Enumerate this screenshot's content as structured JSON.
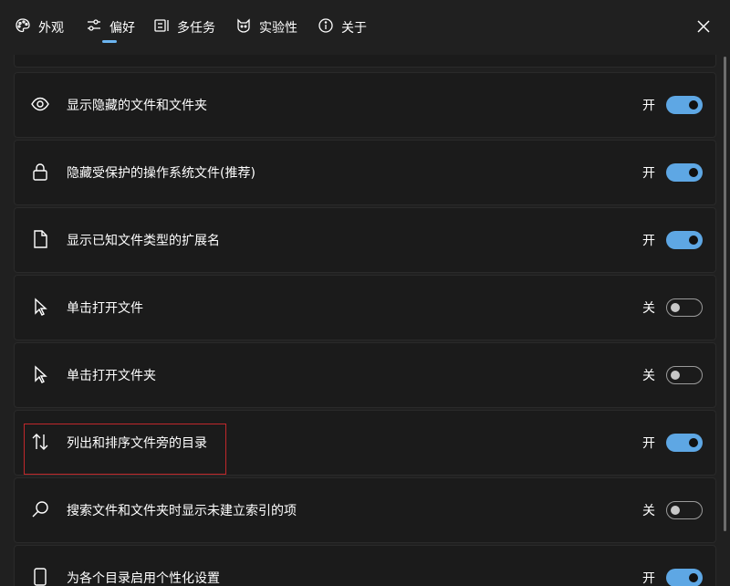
{
  "tabs": [
    {
      "label": "外观",
      "icon": "palette-icon"
    },
    {
      "label": "偏好",
      "icon": "sliders-icon",
      "active": true
    },
    {
      "label": "多任务",
      "icon": "multitask-icon"
    },
    {
      "label": "实验性",
      "icon": "cat-icon"
    },
    {
      "label": "关于",
      "icon": "info-icon"
    }
  ],
  "rows": [
    {
      "label": "显示隐藏的文件和文件夹",
      "state": "开",
      "on": true,
      "icon": "eye-icon"
    },
    {
      "label": "隐藏受保护的操作系统文件(推荐)",
      "state": "开",
      "on": true,
      "icon": "lock-icon"
    },
    {
      "label": "显示已知文件类型的扩展名",
      "state": "开",
      "on": true,
      "icon": "file-icon"
    },
    {
      "label": "单击打开文件",
      "state": "关",
      "on": false,
      "icon": "cursor-icon"
    },
    {
      "label": "单击打开文件夹",
      "state": "关",
      "on": false,
      "icon": "cursor-icon"
    },
    {
      "label": "列出和排序文件旁的目录",
      "state": "开",
      "on": true,
      "icon": "sort-arrows-icon"
    },
    {
      "label": "搜索文件和文件夹时显示未建立索引的项",
      "state": "关",
      "on": false,
      "icon": "search-icon"
    },
    {
      "label": "为各个目录启用个性化设置",
      "state": "开",
      "on": true,
      "icon": "folder-settings-icon"
    }
  ],
  "colors": {
    "accent": "#5ea7e4",
    "highlight": "#c0282b"
  }
}
